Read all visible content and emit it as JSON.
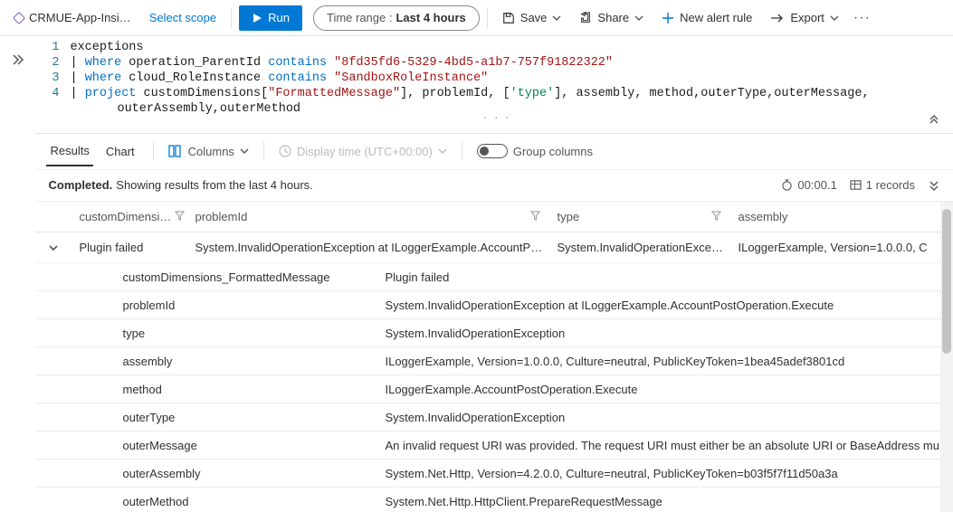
{
  "toolbar": {
    "scope_name": "CRMUE-App-Insi…",
    "select_scope": "Select scope",
    "run": "Run",
    "time_label": "Time range :",
    "time_value": "Last 4 hours",
    "save": "Save",
    "share": "Share",
    "new_alert": "New alert rule",
    "export": "Export"
  },
  "editor": {
    "lines": [
      {
        "n": "1",
        "raw": "exceptions"
      },
      {
        "n": "2",
        "segs": [
          {
            "t": "| ",
            "c": ""
          },
          {
            "t": "where",
            "c": "kw"
          },
          {
            "t": " operation_ParentId ",
            "c": ""
          },
          {
            "t": "contains",
            "c": "kw"
          },
          {
            "t": " ",
            "c": ""
          },
          {
            "t": "\"8fd35fd6-5329-4bd5-a1b7-757f91822322\"",
            "c": "str"
          }
        ]
      },
      {
        "n": "3",
        "segs": [
          {
            "t": "| ",
            "c": ""
          },
          {
            "t": "where",
            "c": "kw"
          },
          {
            "t": " cloud_RoleInstance ",
            "c": ""
          },
          {
            "t": "contains",
            "c": "kw"
          },
          {
            "t": " ",
            "c": ""
          },
          {
            "t": "\"SandboxRoleInstance\"",
            "c": "str"
          }
        ]
      },
      {
        "n": "4",
        "segs": [
          {
            "t": "| ",
            "c": ""
          },
          {
            "t": "project",
            "c": "kw"
          },
          {
            "t": " customDimensions[",
            "c": ""
          },
          {
            "t": "\"FormattedMessage\"",
            "c": "str"
          },
          {
            "t": "], problemId, [",
            "c": ""
          },
          {
            "t": "'type'",
            "c": "str2"
          },
          {
            "t": "], assembly, method,outerType,outerMessage,",
            "c": ""
          }
        ]
      },
      {
        "n": "",
        "cont": "outerAssembly,outerMethod"
      }
    ]
  },
  "result_toolbar": {
    "tab_results": "Results",
    "tab_chart": "Chart",
    "columns": "Columns",
    "display_time": "Display time (UTC+00:00)",
    "group_columns": "Group columns"
  },
  "status": {
    "lead": "Completed.",
    "text": "Showing results from the last 4 hours.",
    "elapsed": "00:00.1",
    "records": "1 records"
  },
  "columns": [
    "customDimensi…",
    "problemId",
    "type",
    "assembly"
  ],
  "row": {
    "c1": "Plugin failed",
    "c2": "System.InvalidOperationException at ILoggerExample.AccountP…",
    "c3": "System.InvalidOperationExce…",
    "c4": "ILoggerExample, Version=1.0.0.0, C"
  },
  "details": [
    {
      "k": "customDimensions_FormattedMessage",
      "v": "Plugin failed"
    },
    {
      "k": "problemId",
      "v": "System.InvalidOperationException at ILoggerExample.AccountPostOperation.Execute"
    },
    {
      "k": "type",
      "v": "System.InvalidOperationException"
    },
    {
      "k": "assembly",
      "v": "ILoggerExample, Version=1.0.0.0, Culture=neutral, PublicKeyToken=1bea45adef3801cd"
    },
    {
      "k": "method",
      "v": "ILoggerExample.AccountPostOperation.Execute"
    },
    {
      "k": "outerType",
      "v": "System.InvalidOperationException"
    },
    {
      "k": "outerMessage",
      "v": "An invalid request URI was provided. The request URI must either be an absolute URI or BaseAddress must be"
    },
    {
      "k": "outerAssembly",
      "v": "System.Net.Http, Version=4.2.0.0, Culture=neutral, PublicKeyToken=b03f5f7f11d50a3a"
    },
    {
      "k": "outerMethod",
      "v": "System.Net.Http.HttpClient.PrepareRequestMessage"
    }
  ]
}
